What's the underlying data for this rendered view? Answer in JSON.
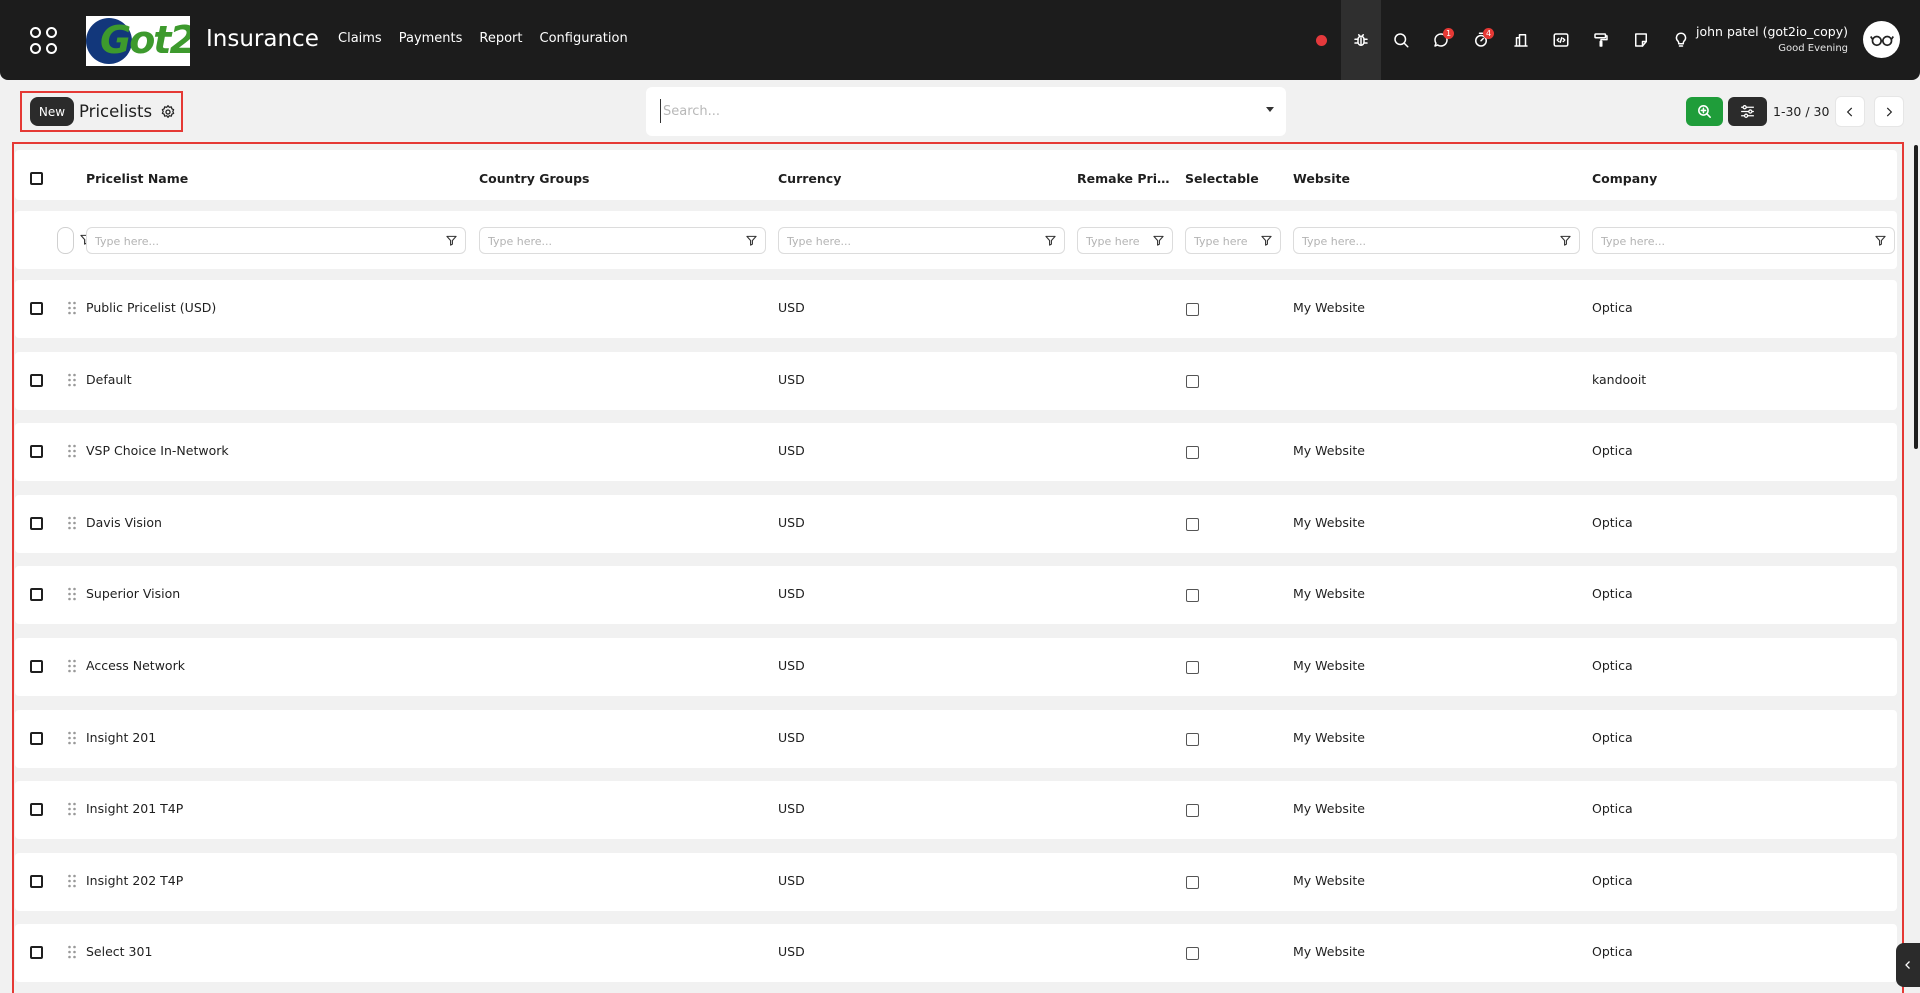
{
  "navbar": {
    "logo_text": "Got2",
    "app_name": "Insurance",
    "menu": [
      "Claims",
      "Payments",
      "Report",
      "Configuration"
    ],
    "icons": [
      "record-icon",
      "bug-icon",
      "search-icon",
      "chat-icon",
      "timer-icon",
      "bank-icon",
      "code-icon",
      "paint-roller-icon",
      "note-icon",
      "lightbulb-icon"
    ],
    "chat_badge": "1",
    "activity_badge": "4",
    "user_name": "john patel (got2io_copy)",
    "greeting": "Good Evening"
  },
  "control_panel": {
    "new_label": "New",
    "title": "Pricelists",
    "search_placeholder": "Search...",
    "pager": "1-30 / 30"
  },
  "table": {
    "columns": [
      "Pricelist Name",
      "Country Groups",
      "Currency",
      "Remake Pricelist",
      "Selectable",
      "Website",
      "Company"
    ],
    "filter_placeholder_long": "Type here...",
    "filter_placeholder_short": "Type here",
    "rows": [
      {
        "name": "Public Pricelist (USD)",
        "currency": "USD",
        "website": "My Website",
        "company": "Optica"
      },
      {
        "name": "Default",
        "currency": "USD",
        "website": "",
        "company": "kandooit"
      },
      {
        "name": "VSP Choice In-Network",
        "currency": "USD",
        "website": "My Website",
        "company": "Optica"
      },
      {
        "name": "Davis Vision",
        "currency": "USD",
        "website": "My Website",
        "company": "Optica"
      },
      {
        "name": "Superior Vision",
        "currency": "USD",
        "website": "My Website",
        "company": "Optica"
      },
      {
        "name": "Access Network",
        "currency": "USD",
        "website": "My Website",
        "company": "Optica"
      },
      {
        "name": "Insight 201",
        "currency": "USD",
        "website": "My Website",
        "company": "Optica"
      },
      {
        "name": "Insight 201 T4P",
        "currency": "USD",
        "website": "My Website",
        "company": "Optica"
      },
      {
        "name": "Insight 202 T4P",
        "currency": "USD",
        "website": "My Website",
        "company": "Optica"
      },
      {
        "name": "Select 301",
        "currency": "USD",
        "website": "My Website",
        "company": "Optica"
      }
    ]
  },
  "colors": {
    "navbar_bg": "#1c1c1c",
    "highlight_border": "#e53935",
    "zoom_button": "#1f9d3a",
    "badge": "#e53935"
  }
}
